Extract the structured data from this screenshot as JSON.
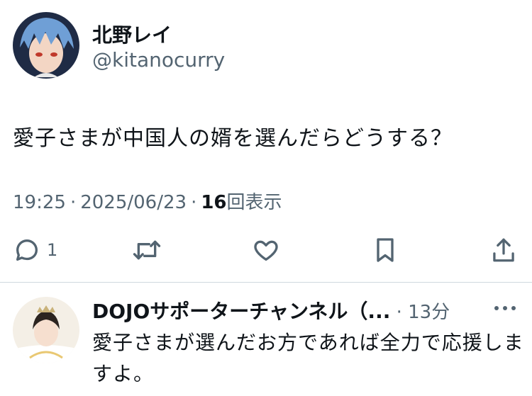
{
  "tweet": {
    "author_name": "北野レイ",
    "author_handle": "@kitanocurry",
    "text": "愛子さまが中国人の婿を選んだらどうする？",
    "time": "19:25",
    "date": "2025/06/23",
    "views_count": "16",
    "views_label": "回表示"
  },
  "actions": {
    "reply_count": "1",
    "icons": [
      "reply-icon",
      "retweet-icon",
      "like-icon",
      "bookmark-icon",
      "share-icon"
    ]
  },
  "reply": {
    "author_name": "DOJOサポーターチャンネル（...",
    "time": "13分",
    "text": "愛子さまが選んだお方であれば全力で応援しますよ。"
  },
  "colors": {
    "text": "#0f1419",
    "secondary": "#536471",
    "divider": "#cfd9de"
  }
}
